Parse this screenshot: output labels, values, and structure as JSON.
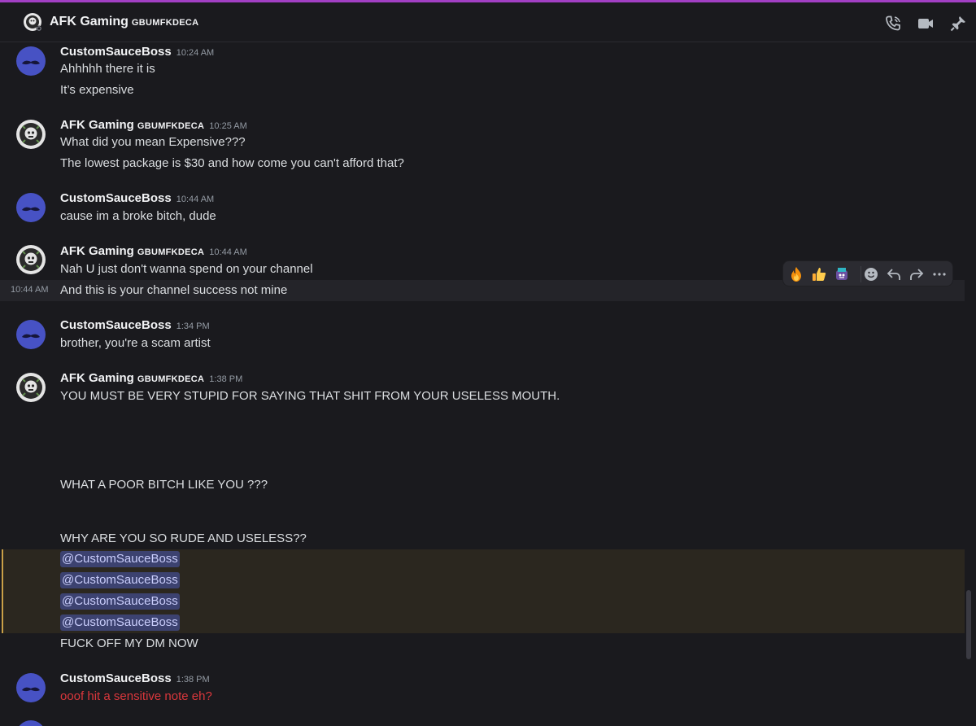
{
  "header": {
    "name": "AFK Gaming",
    "tag": "GBUMFKDECA"
  },
  "messages": [
    {
      "author": "CustomSauceBoss",
      "tag": "",
      "time": "10:24 AM",
      "lines": [
        "Ahhhhh there it is",
        "It’s expensive"
      ]
    },
    {
      "author": "AFK Gaming",
      "tag": "GBUMFKDECA",
      "time": "10:25 AM",
      "lines": [
        "What did you mean Expensive???",
        "The lowest package is $30 and how come you can't afford that?"
      ]
    },
    {
      "author": "CustomSauceBoss",
      "tag": "",
      "time": "10:44 AM",
      "lines": [
        "cause im a broke bitch, dude"
      ]
    },
    {
      "author": "AFK Gaming",
      "tag": "GBUMFKDECA",
      "time": "10:44 AM",
      "lines": [
        "Nah U just don't wanna spend on your channel",
        "And this is your channel  success not mine"
      ],
      "hover_time": "10:44 AM"
    },
    {
      "author": "CustomSauceBoss",
      "tag": "",
      "time": "1:34 PM",
      "lines": [
        "brother, you're a scam artist"
      ]
    },
    {
      "author": "AFK Gaming",
      "tag": "GBUMFKDECA",
      "time": "1:38 PM",
      "lines": [
        "YOU MUST BE VERY STUPID FOR SAYING THAT SHIT FROM YOUR USELESS MOUTH.",
        "WHAT A POOR BITCH LIKE YOU ???",
        "WHY ARE YOU SO RUDE AND USELESS??",
        "FUCK OFF MY DM NOW"
      ],
      "mentions": [
        "@CustomSauceBoss",
        "@CustomSauceBoss",
        "@CustomSauceBoss",
        "@CustomSauceBoss"
      ]
    },
    {
      "author": "CustomSauceBoss",
      "tag": "",
      "time": "1:38 PM",
      "lines": [
        "ooof hit a sensitive note eh?"
      ]
    }
  ],
  "toolbar": {
    "icons": [
      "fire-emoji",
      "thumbs-up-emoji",
      "custom-emoji",
      "add-reaction-icon",
      "reply-icon",
      "forward-icon",
      "more-icon"
    ]
  },
  "colors": {
    "accent": "#a23fc4",
    "mention_bg": "#3c4270",
    "highlight_bar": "#c9a047",
    "red_text": "#da373c",
    "avatar_blue": "#4752c4"
  }
}
